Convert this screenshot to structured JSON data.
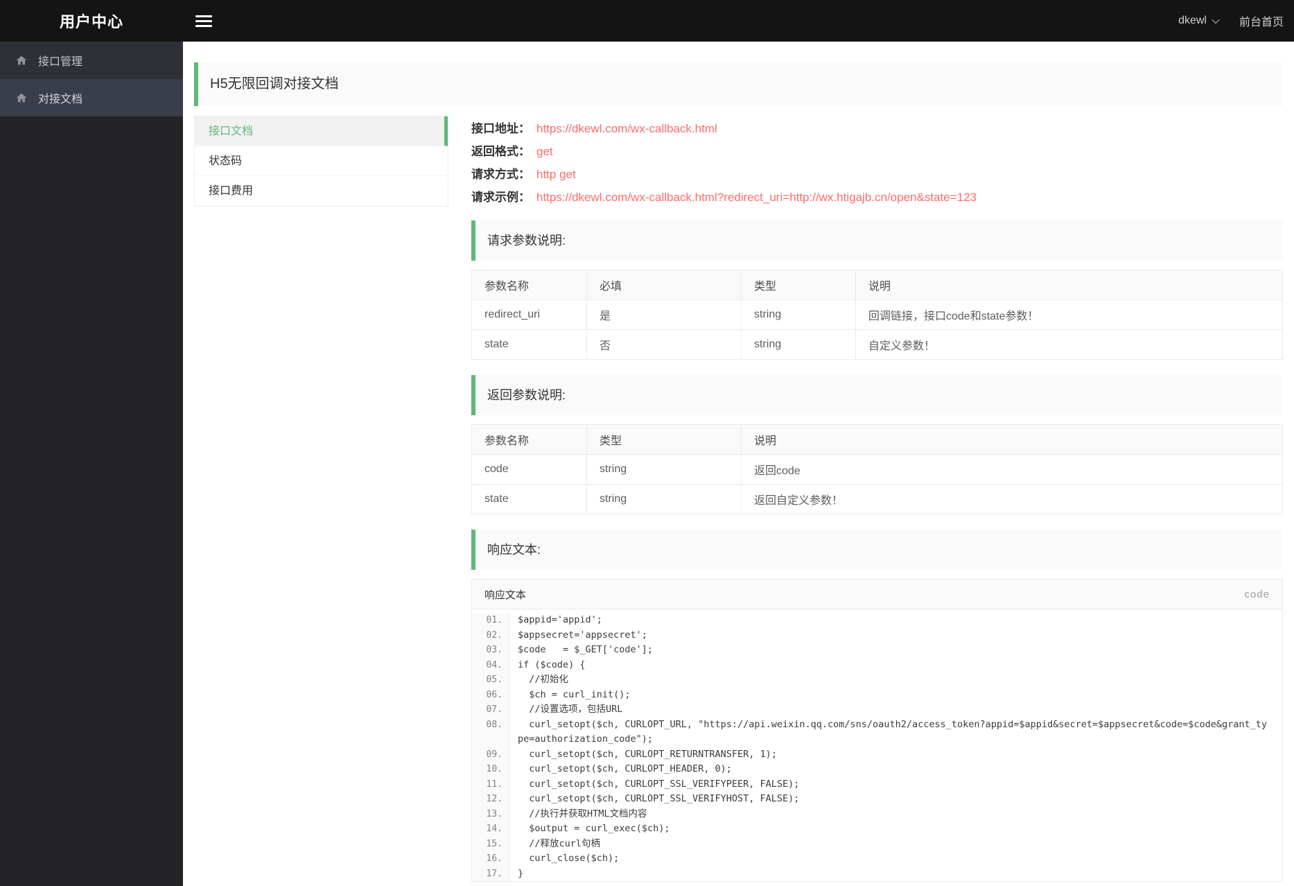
{
  "header": {
    "brand": "用户中心",
    "user": "dkewl",
    "home_link": "前台首页"
  },
  "icons": {
    "menu": "hamburger-icon",
    "user_caret": "chevron-down-icon",
    "sidebar_item": "home-icon"
  },
  "colors": {
    "accent_green": "#5FB878",
    "value_red": "#ff6b6b",
    "header_bg": "#141414",
    "sidebar_bg": "#242428"
  },
  "sidebar": {
    "items": [
      {
        "label": "接口管理",
        "active": false
      },
      {
        "label": "对接文档",
        "active": true
      }
    ]
  },
  "page": {
    "title": "H5无限回调对接文档"
  },
  "subnav": {
    "items": [
      {
        "label": "接口文档",
        "active": true
      },
      {
        "label": "状态码",
        "active": false
      },
      {
        "label": "接口费用",
        "active": false
      }
    ]
  },
  "api_info": {
    "rows": [
      {
        "label": "接口地址：",
        "value": "https://dkewl.com/wx-callback.html"
      },
      {
        "label": "返回格式：",
        "value": "get"
      },
      {
        "label": "请求方式：",
        "value": "http get"
      },
      {
        "label": "请求示例：",
        "value": "https://dkewl.com/wx-callback.html?redirect_uri=http://wx.htigajb.cn/open&state=123"
      }
    ]
  },
  "request_params": {
    "title": "请求参数说明:",
    "headers": [
      "参数名称",
      "必填",
      "类型",
      "说明"
    ],
    "rows": [
      [
        "redirect_uri",
        "是",
        "string",
        "回调链接，接口code和state参数！"
      ],
      [
        "state",
        "否",
        "string",
        "自定义参数！"
      ]
    ]
  },
  "response_params": {
    "title": "返回参数说明:",
    "headers": [
      "参数名称",
      "类型",
      "说明"
    ],
    "rows": [
      [
        "code",
        "string",
        "返回code"
      ],
      [
        "state",
        "string",
        "返回自定义参数！"
      ]
    ]
  },
  "response_section": {
    "title": "响应文本:",
    "panel_title": "响应文本",
    "panel_badge": "code",
    "code_lines": [
      {
        "num": "01.",
        "text": "$appid='appid';"
      },
      {
        "num": "02.",
        "text": "$appsecret='appsecret';"
      },
      {
        "num": "03.",
        "text": "$code   = $_GET['code'];"
      },
      {
        "num": "04.",
        "text": "if ($code) {"
      },
      {
        "num": "05.",
        "text": "  //初始化"
      },
      {
        "num": "06.",
        "text": "  $ch = curl_init();"
      },
      {
        "num": "07.",
        "text": "  //设置选项，包括URL"
      },
      {
        "num": "08.",
        "text": "  curl_setopt($ch, CURLOPT_URL, \"https://api.weixin.qq.com/sns/oauth2/access_token?appid=$appid&secret=$appsecret&code=$code&grant_type=authorization_code\");"
      },
      {
        "num": "09.",
        "text": "  curl_setopt($ch, CURLOPT_RETURNTRANSFER, 1);"
      },
      {
        "num": "10.",
        "text": "  curl_setopt($ch, CURLOPT_HEADER, 0);"
      },
      {
        "num": "11.",
        "text": "  curl_setopt($ch, CURLOPT_SSL_VERIFYPEER, FALSE);"
      },
      {
        "num": "12.",
        "text": "  curl_setopt($ch, CURLOPT_SSL_VERIFYHOST, FALSE);"
      },
      {
        "num": "13.",
        "text": "  //执行并获取HTML文档内容"
      },
      {
        "num": "14.",
        "text": "  $output = curl_exec($ch);"
      },
      {
        "num": "15.",
        "text": "  //释放curl句柄"
      },
      {
        "num": "16.",
        "text": "  curl_close($ch);"
      },
      {
        "num": "17.",
        "text": "}"
      }
    ]
  }
}
